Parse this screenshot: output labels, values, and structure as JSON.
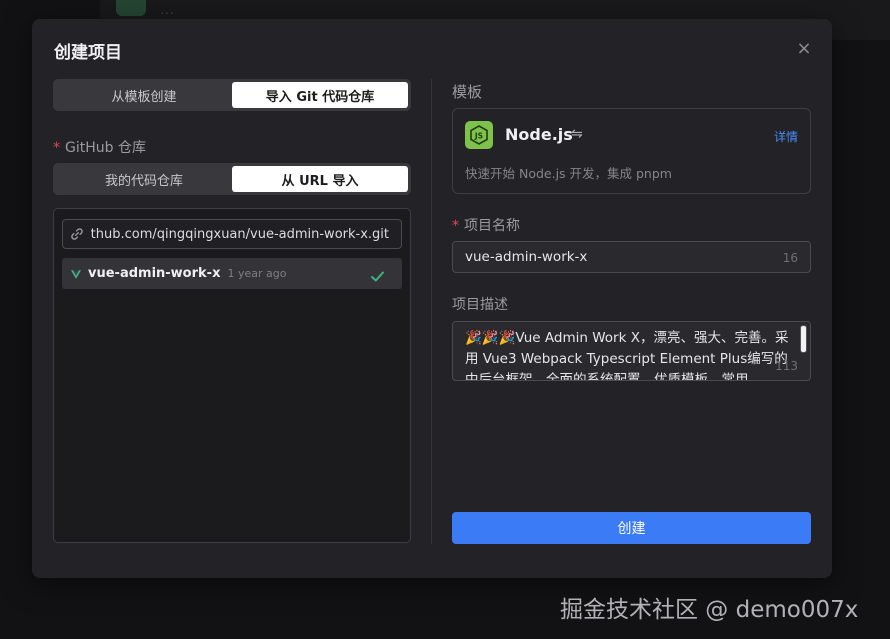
{
  "background": {
    "text": "…"
  },
  "dialog": {
    "title": "创建项目",
    "close_icon": "×"
  },
  "source_tabs": {
    "options": [
      "从模板创建",
      "导入 Git 代码仓库"
    ],
    "selected": "导入 Git 代码仓库"
  },
  "github": {
    "label": "GitHub 仓库",
    "required": "*",
    "tabs": [
      "我的代码仓库",
      "从 URL 导入"
    ],
    "selected_tab": "从 URL 导入",
    "url_value": "https://github.com/qingqingxuan/vue-admin-work-x.git",
    "repos": [
      {
        "name": "vue-admin-work-x",
        "time": "1 year ago",
        "selected": true
      }
    ]
  },
  "template": {
    "section_label": "模板",
    "name": "Node.js",
    "swap_icon": "⇋",
    "detail_link": "详情",
    "description": "快速开始 Node.js 开发，集成 pnpm"
  },
  "project_name": {
    "label": "项目名称",
    "required": "*",
    "value": "vue-admin-work-x",
    "count": "16"
  },
  "project_desc": {
    "label": "项目描述",
    "value": "🎉🎉🎉Vue Admin Work X，漂亮、强大、完善。采用 Vue3 Webpack Typescript Element Plus编写的中后台框架，全面的系统配置，优质模板，常用",
    "count": "113"
  },
  "submit_label": "创建",
  "watermark": "掘金技术社区 @ demo007x",
  "colors": {
    "accent": "#3b7cf6",
    "node_green": "#7ec14b",
    "vue_green": "#41b883",
    "required_red": "#e5484d"
  }
}
